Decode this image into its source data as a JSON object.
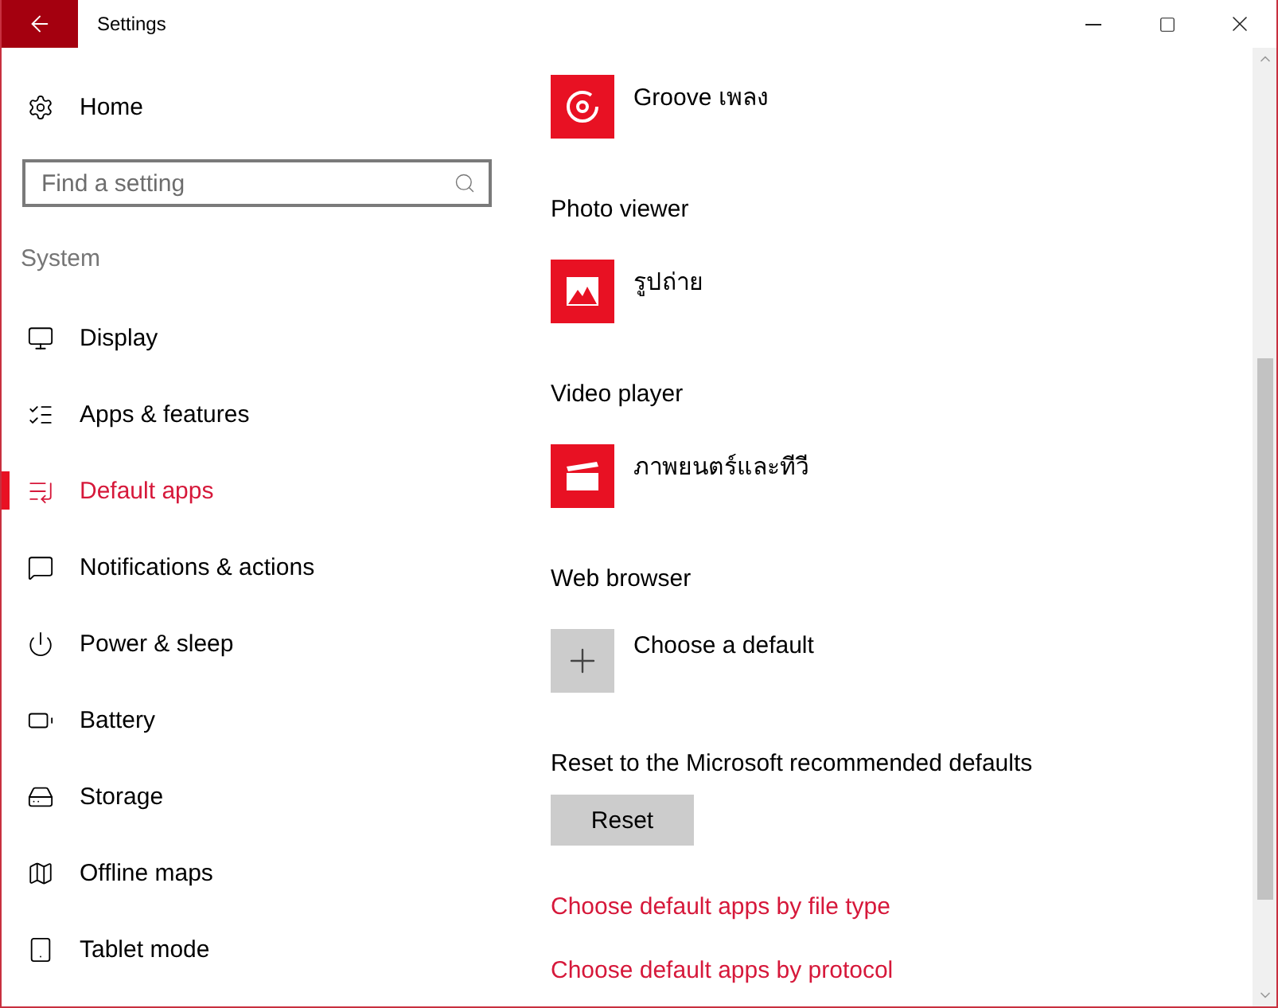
{
  "window": {
    "title": "Settings"
  },
  "sidebar": {
    "home": "Home",
    "search": {
      "placeholder": "Find a setting"
    },
    "group": "System",
    "items": [
      {
        "label": "Display",
        "kind": "display",
        "selected": false
      },
      {
        "label": "Apps & features",
        "kind": "apps",
        "selected": false
      },
      {
        "label": "Default apps",
        "kind": "defaults",
        "selected": true
      },
      {
        "label": "Notifications & actions",
        "kind": "notifications",
        "selected": false
      },
      {
        "label": "Power & sleep",
        "kind": "power",
        "selected": false
      },
      {
        "label": "Battery",
        "kind": "battery",
        "selected": false
      },
      {
        "label": "Storage",
        "kind": "storage",
        "selected": false
      },
      {
        "label": "Offline maps",
        "kind": "maps",
        "selected": false
      },
      {
        "label": "Tablet mode",
        "kind": "tablet",
        "selected": false
      }
    ]
  },
  "sections": [
    {
      "app": {
        "name": "Groove เพลง",
        "kind": "music"
      }
    },
    {
      "heading": "Photo viewer",
      "app": {
        "name": "รูปถ่าย",
        "kind": "photos"
      }
    },
    {
      "heading": "Video player",
      "app": {
        "name": "ภาพยนตร์และทีวี",
        "kind": "video"
      }
    },
    {
      "heading": "Web browser",
      "app": {
        "name": "Choose a default",
        "kind": "add"
      }
    }
  ],
  "reset": {
    "label": "Reset to the Microsoft recommended defaults",
    "button": "Reset"
  },
  "links": [
    "Choose default apps by file type",
    "Choose default apps by protocol"
  ]
}
